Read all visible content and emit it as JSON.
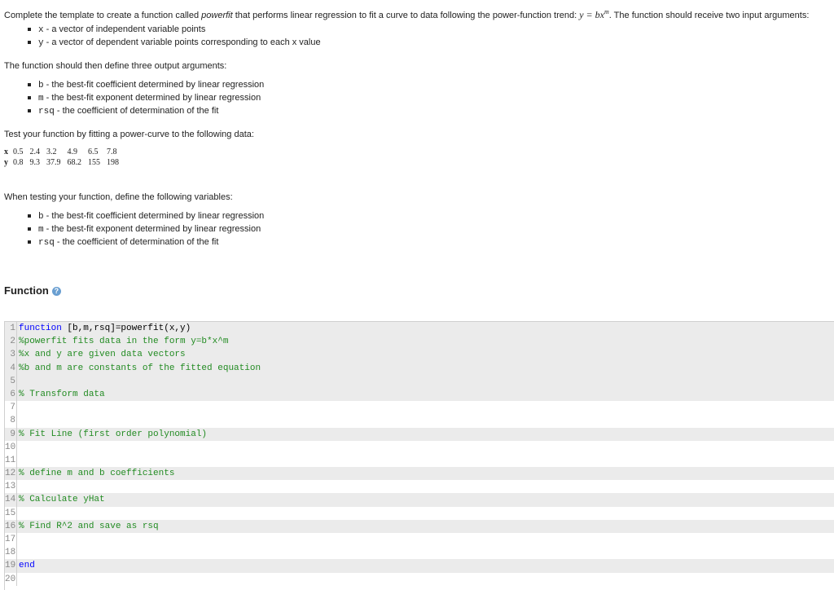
{
  "intro": {
    "pre": "Complete the template to create a function called ",
    "func_name": "powerfit",
    "mid": " that performs linear regression to fit a curve to data following the power-function trend: ",
    "equation_lhs": "y = bx",
    "equation_exp": "m",
    "post": ". The function should receive two input arguments:"
  },
  "inputs": [
    {
      "code": "x",
      "text": " - a vector of independent variable points"
    },
    {
      "code": "y",
      "text": " - a vector of dependent variable points corresponding to each x value"
    }
  ],
  "outputs_intro": "The function should then define three output arguments:",
  "outputs": [
    {
      "code": "b",
      "text": " - the best-fit coefficient determined by linear regression"
    },
    {
      "code": "m",
      "text": " - the best-fit exponent determined by linear regression"
    },
    {
      "code": "rsq",
      "text": " - the coefficient of determination of the fit"
    }
  ],
  "test_intro": "Test your function by fitting a power-curve to the following data:",
  "data_table": {
    "x_label": "x",
    "y_label": "y",
    "x": [
      "0.5",
      "2.4",
      "3.2",
      "4.9",
      "6.5",
      "7.8"
    ],
    "y": [
      "0.8",
      "9.3",
      "37.9",
      "68.2",
      "155",
      "198"
    ]
  },
  "testing_intro": "When testing your function, define the following variables:",
  "testing_vars": [
    {
      "code": "b",
      "text": " - the best-fit coefficient determined by linear regression"
    },
    {
      "code": "m",
      "text": " - the best-fit exponent determined by linear regression"
    },
    {
      "code": "rsq",
      "text": " - the coefficient of determination of the fit"
    }
  ],
  "section_title": "Function",
  "help_icon": "?",
  "editor": {
    "lines": [
      {
        "n": "1",
        "locked": true,
        "parts": [
          {
            "t": "function",
            "c": "kw"
          },
          {
            "t": " [b,m,rsq]=powerfit(x,y)",
            "c": "plain"
          }
        ]
      },
      {
        "n": "2",
        "locked": true,
        "parts": [
          {
            "t": "%powerfit fits data in the form y=b*x^m",
            "c": "cmt"
          }
        ]
      },
      {
        "n": "3",
        "locked": true,
        "parts": [
          {
            "t": "%x and y are given data vectors",
            "c": "cmt"
          }
        ]
      },
      {
        "n": "4",
        "locked": true,
        "parts": [
          {
            "t": "%b and m are constants of the fitted equation",
            "c": "cmt"
          }
        ]
      },
      {
        "n": "5",
        "locked": true,
        "parts": []
      },
      {
        "n": "6",
        "locked": true,
        "parts": [
          {
            "t": "% Transform data",
            "c": "cmt"
          }
        ]
      },
      {
        "n": "7",
        "locked": false,
        "parts": []
      },
      {
        "n": "8",
        "locked": false,
        "parts": []
      },
      {
        "n": "9",
        "locked": true,
        "parts": [
          {
            "t": "% Fit Line (first order polynomial)",
            "c": "cmt"
          }
        ]
      },
      {
        "n": "10",
        "locked": false,
        "parts": []
      },
      {
        "n": "11",
        "locked": false,
        "parts": []
      },
      {
        "n": "12",
        "locked": true,
        "parts": [
          {
            "t": "% define m and b coefficients",
            "c": "cmt"
          }
        ]
      },
      {
        "n": "13",
        "locked": false,
        "parts": []
      },
      {
        "n": "14",
        "locked": true,
        "parts": [
          {
            "t": "% Calculate yHat",
            "c": "cmt"
          }
        ]
      },
      {
        "n": "15",
        "locked": false,
        "parts": []
      },
      {
        "n": "16",
        "locked": true,
        "parts": [
          {
            "t": "% Find R^2 and save as rsq",
            "c": "cmt"
          }
        ]
      },
      {
        "n": "17",
        "locked": false,
        "parts": []
      },
      {
        "n": "18",
        "locked": false,
        "parts": []
      },
      {
        "n": "19",
        "locked": true,
        "parts": [
          {
            "t": "end",
            "c": "kw"
          }
        ]
      },
      {
        "n": "20",
        "locked": false,
        "parts": []
      }
    ]
  }
}
